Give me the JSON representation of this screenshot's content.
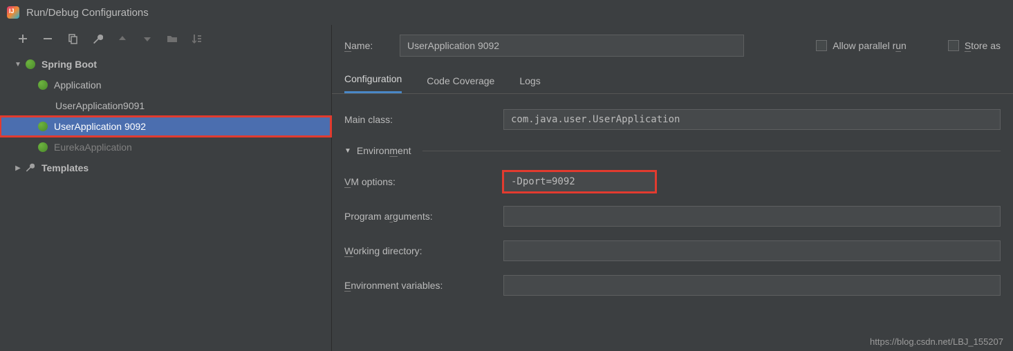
{
  "window": {
    "title": "Run/Debug Configurations"
  },
  "toolbar": {
    "add": "add-icon",
    "remove": "remove-icon",
    "copy": "copy-icon",
    "settings": "settings-icon",
    "up": "up-icon",
    "down": "down-icon",
    "folder": "folder-move-icon",
    "sort": "sort-alpha-icon"
  },
  "tree": {
    "springBoot": {
      "label": "Spring Boot"
    },
    "items": [
      {
        "label": "Application"
      },
      {
        "label": "UserApplication9091"
      },
      {
        "label": "UserApplication 9092",
        "selected": true
      },
      {
        "label": "EurekaApplication",
        "dim": true
      }
    ],
    "templates": {
      "label": "Templates"
    }
  },
  "form": {
    "nameLabel": "Name:",
    "nameValue": "UserApplication 9092",
    "allowParallel": "Allow parallel run",
    "storeAs": "Store as"
  },
  "tabs": [
    {
      "label": "Configuration",
      "active": true
    },
    {
      "label": "Code Coverage"
    },
    {
      "label": "Logs"
    }
  ],
  "config": {
    "mainClassLabel": "Main class:",
    "mainClassValue": "com.java.user.UserApplication",
    "environmentLabel": "Environment",
    "vmLabel": "VM options:",
    "vmValue": "-Dport=9092",
    "argsLabel": "Program arguments:",
    "argsValue": "",
    "wdLabel": "Working directory:",
    "wdValue": "",
    "envLabel": "Environment variables:",
    "envValue": ""
  },
  "watermark": "https://blog.csdn.net/LBJ_155207"
}
